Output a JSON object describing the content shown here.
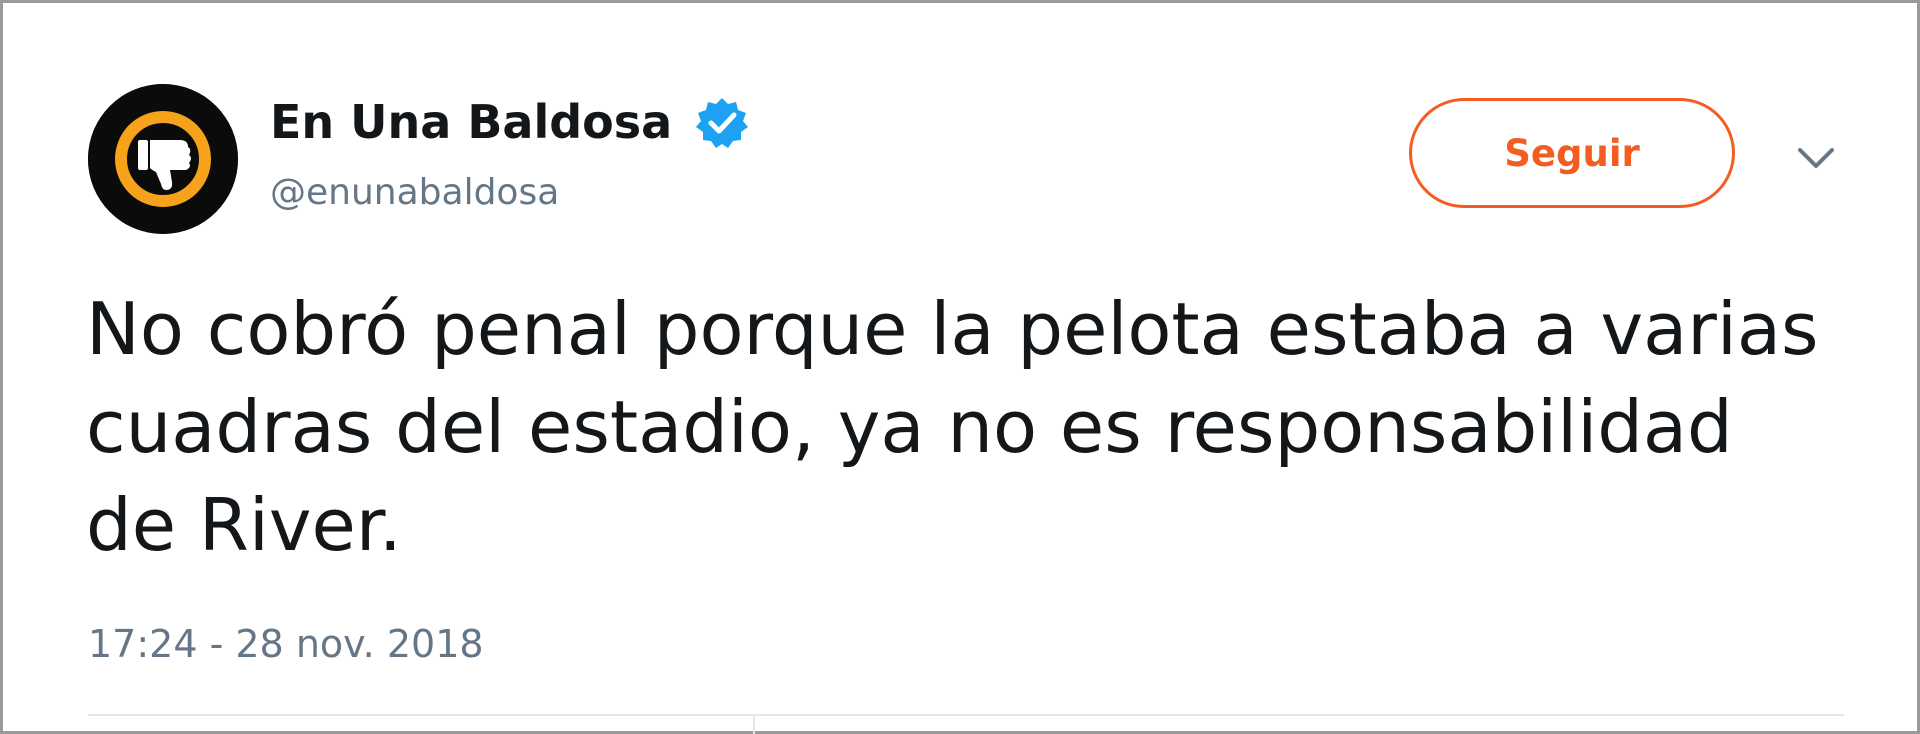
{
  "tweet": {
    "display_name": "En Una Baldosa",
    "handle": "@enunabaldosa",
    "verified": true,
    "follow_label": "Seguir",
    "text": "No cobró penal porque la pelota estaba a varias cuadras del estadio, ya no es responsabilidad de River.",
    "timestamp": "17:24 - 28 nov. 2018"
  },
  "icons": {
    "avatar": "thumbs-down-logo",
    "verified": "verified-badge-icon",
    "menu": "chevron-down-icon"
  },
  "colors": {
    "accent": "#f45d22",
    "verified": "#1da1f2",
    "text_primary": "#14171a",
    "text_secondary": "#657786",
    "avatar_bg": "#0b0b0b",
    "avatar_ring": "#f7a21b"
  }
}
